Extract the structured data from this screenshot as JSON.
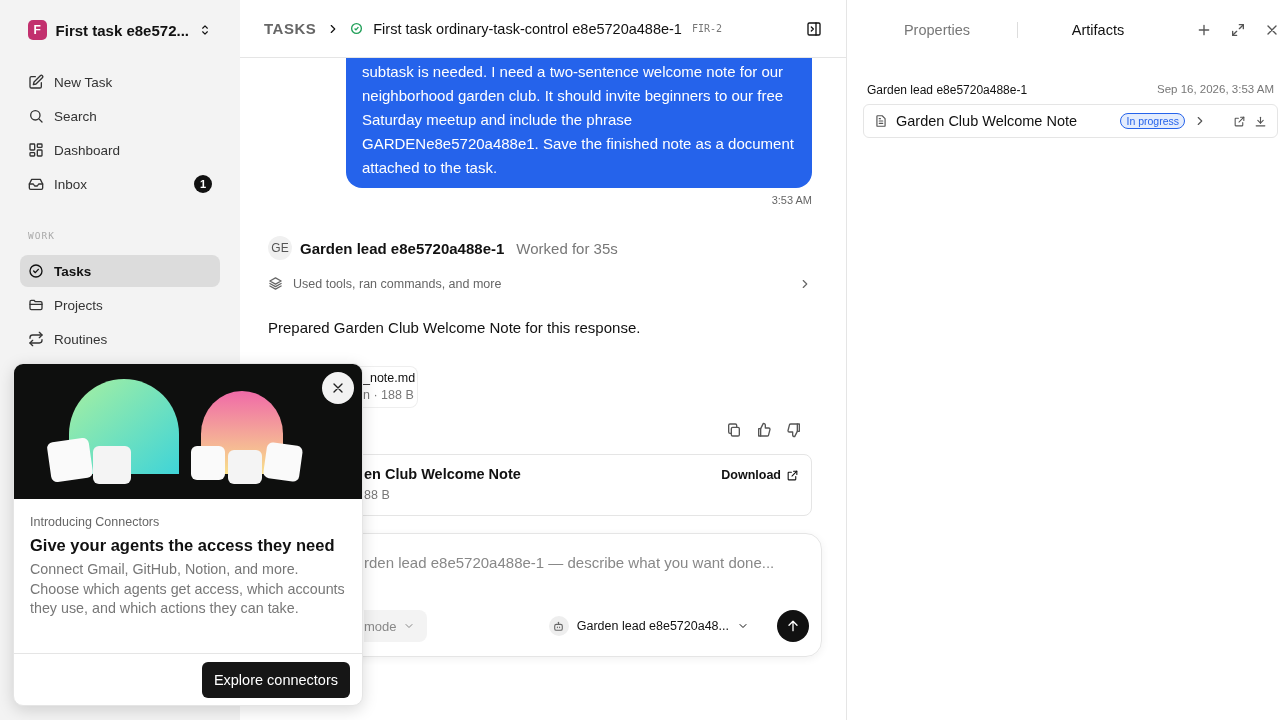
{
  "sidebar": {
    "workspace": {
      "logo_letter": "F",
      "name": "First task e8e572..."
    },
    "nav": [
      {
        "label": "New Task"
      },
      {
        "label": "Search"
      },
      {
        "label": "Dashboard"
      },
      {
        "label": "Inbox",
        "badge": "1"
      }
    ],
    "section_label": "WORK",
    "work_items": [
      {
        "label": "Tasks",
        "selected": true
      },
      {
        "label": "Projects",
        "selected": false
      },
      {
        "label": "Routines",
        "selected": false
      }
    ]
  },
  "header": {
    "breadcrumb": "TASKS",
    "title": "First task ordinary-task-control e8e5720a488e-1",
    "key": "FIR-2"
  },
  "conversation": {
    "user_message": {
      "text": "subtask is needed. I need a two-sentence welcome note for our neighborhood garden club. It should invite beginners to our free Saturday meetup and include the phrase GARDENe8e5720a488e1. Save the finished note as a document attached to the task.",
      "time": "3:53 AM"
    },
    "agent": {
      "avatar": "GE",
      "name": "Garden lead e8e5720a488e-1",
      "status": "Worked for 35s"
    },
    "tools_summary": "Used tools, ran commands, and more",
    "response": "Prepared Garden Club Welcome Note for this response.",
    "attachment": {
      "name": "_note.md",
      "meta": "n · 188 B"
    },
    "document": {
      "title": "en Club Welcome Note",
      "meta": "88 B",
      "action": "Download"
    }
  },
  "composer": {
    "placeholder": "rden lead e8e5720a488e-1 — describe what you want done...",
    "mode": "mode",
    "agent": "Garden lead e8e5720a48..."
  },
  "right_panel": {
    "tabs": [
      {
        "label": "Properties",
        "selected": false
      },
      {
        "label": "Artifacts",
        "selected": true
      }
    ],
    "groups": [
      {
        "author": "Garden lead e8e5720a488e-1",
        "date": "Sep 16, 2026, 3:53 AM",
        "items": [
          {
            "title": "Garden Club Welcome Note",
            "status": "In progress"
          }
        ]
      }
    ]
  },
  "popup": {
    "eyebrow": "Introducing Connectors",
    "title": "Give your agents the access they need",
    "body": "Connect Gmail, GitHub, Notion, and more. Choose which agents get access, which accounts they use, and which actions they can take.",
    "button": "Explore connectors"
  }
}
